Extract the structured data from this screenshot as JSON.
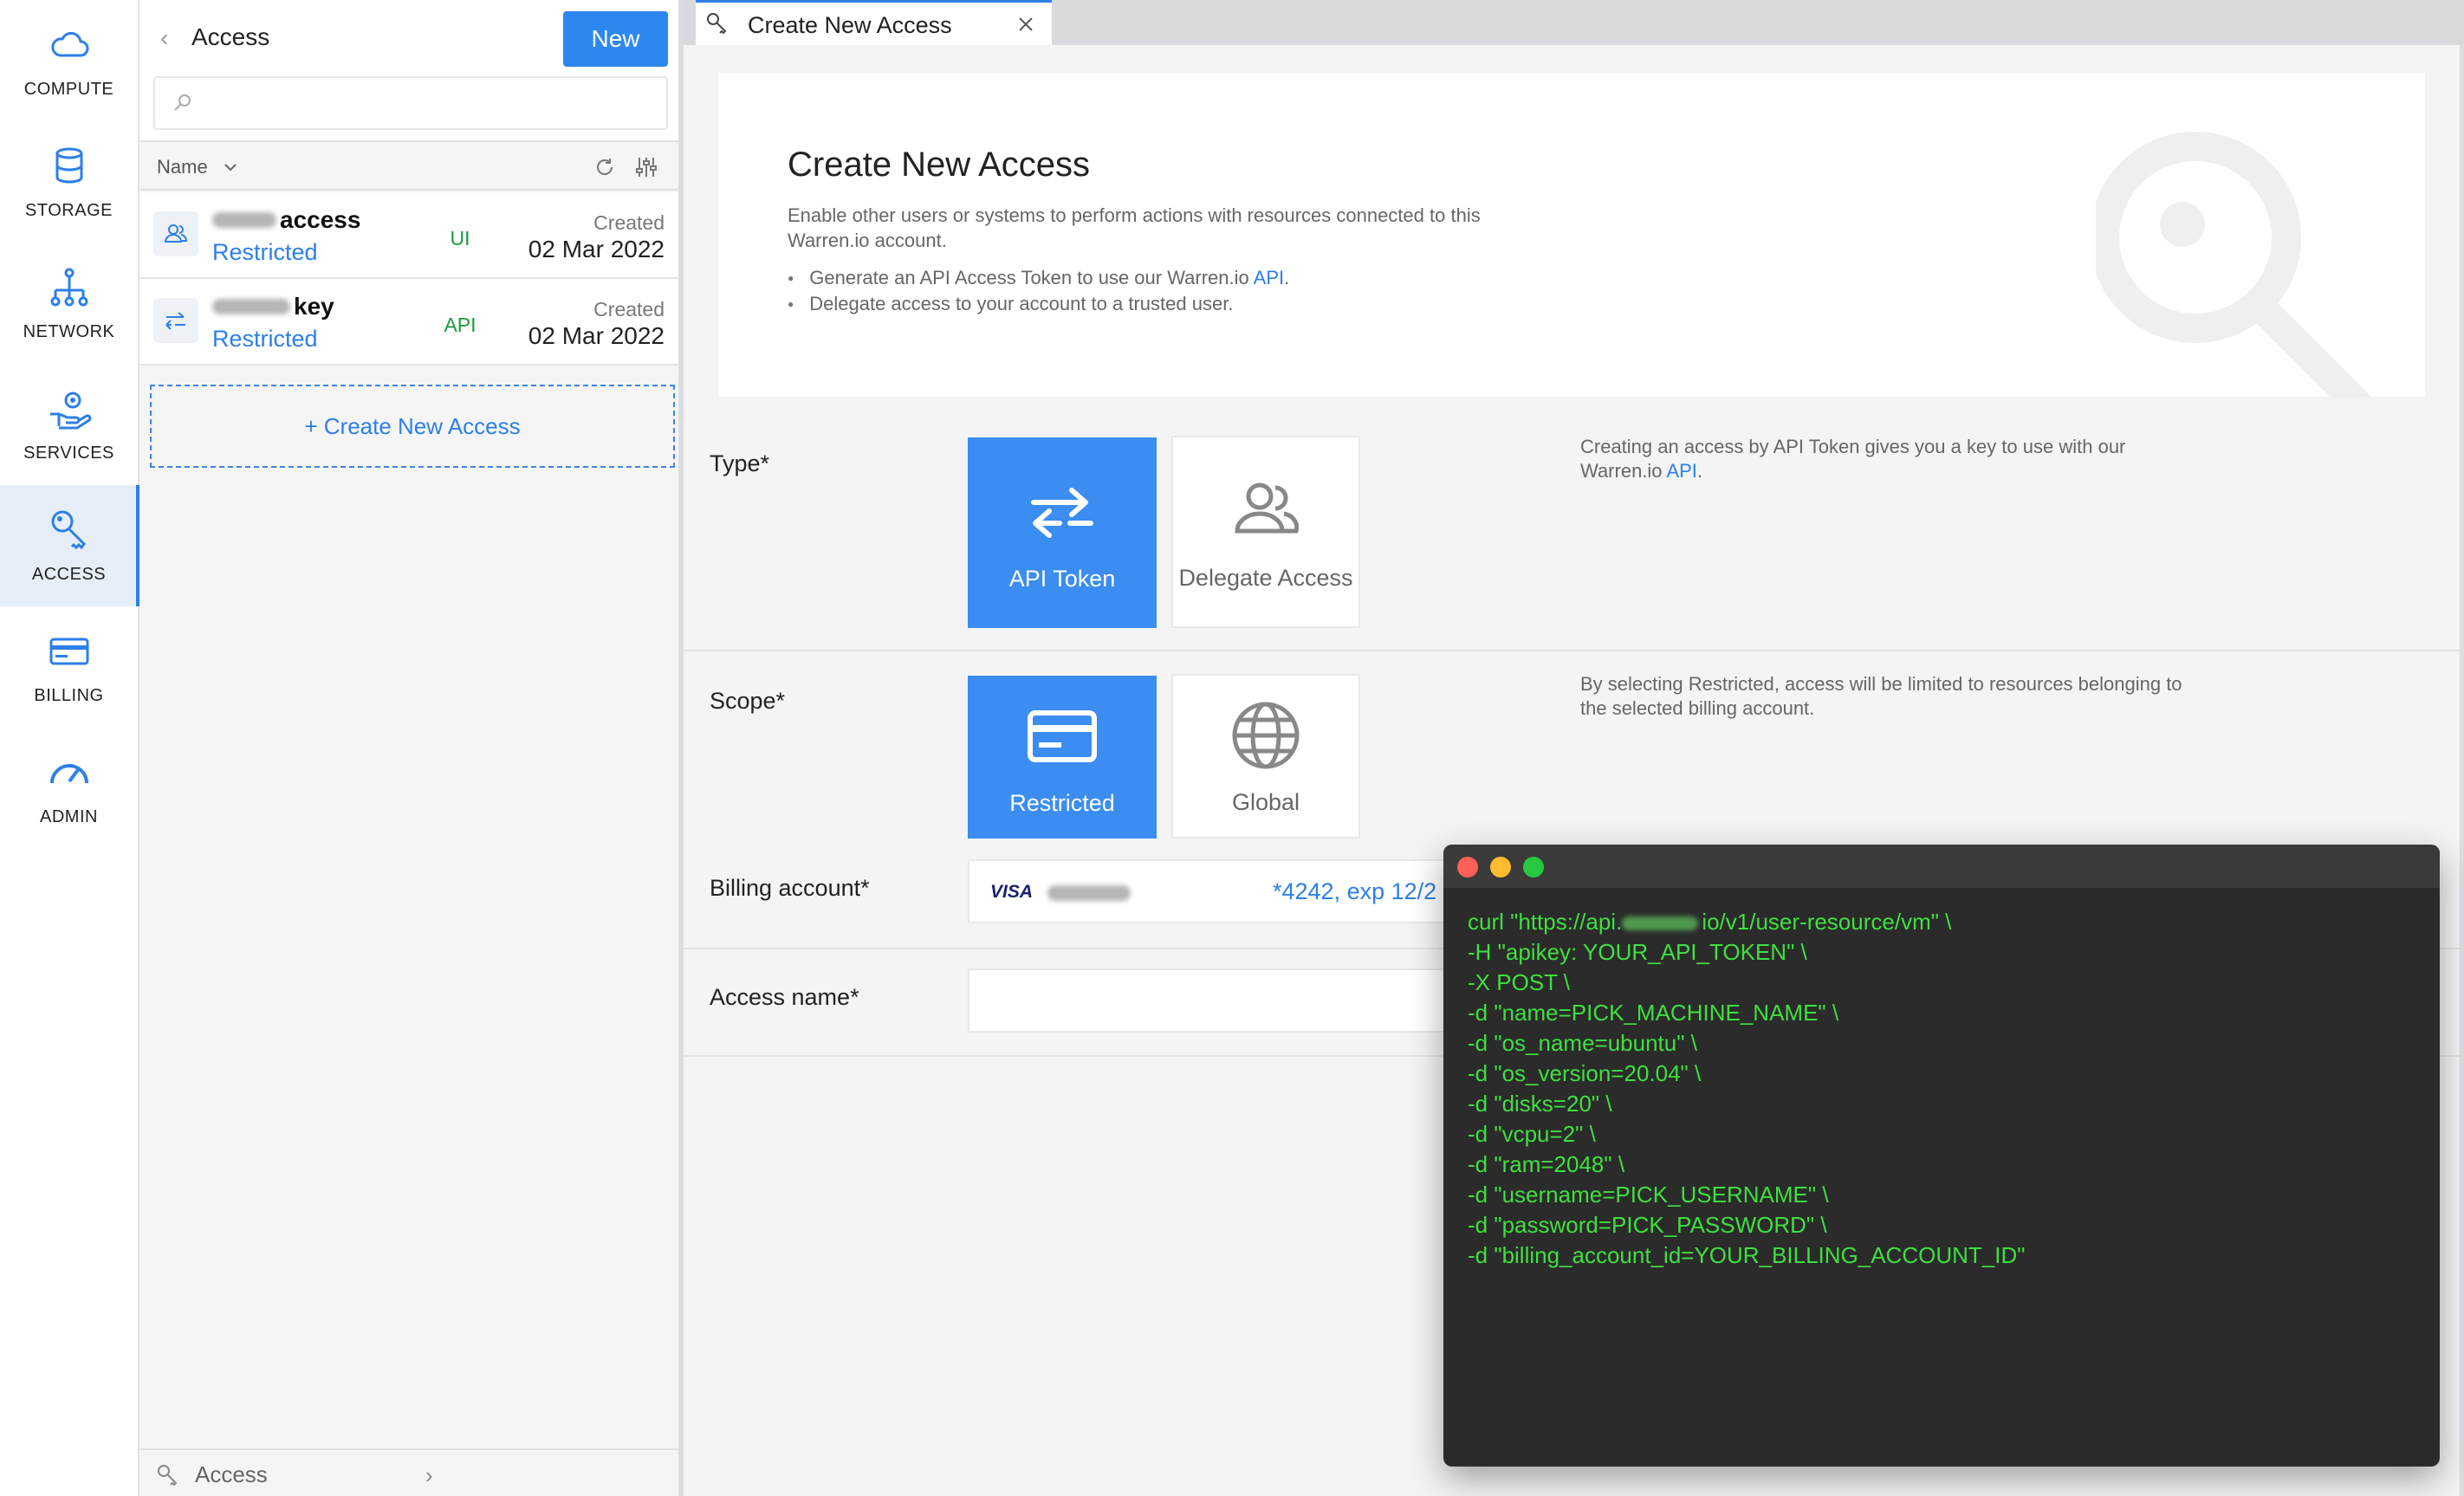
{
  "nav": {
    "items": [
      {
        "label": "COMPUTE",
        "icon": "cloud-icon"
      },
      {
        "label": "STORAGE",
        "icon": "database-icon"
      },
      {
        "label": "NETWORK",
        "icon": "network-icon"
      },
      {
        "label": "SERVICES",
        "icon": "services-icon"
      },
      {
        "label": "ACCESS",
        "icon": "key-icon",
        "active": true
      },
      {
        "label": "BILLING",
        "icon": "card-icon"
      },
      {
        "label": "ADMIN",
        "icon": "gauge-icon"
      }
    ]
  },
  "list": {
    "title": "Access",
    "new_label": "New",
    "search_placeholder": "",
    "col_name": "Name",
    "rows": [
      {
        "name": "access",
        "scope": "Restricted",
        "type": "UI",
        "created_label": "Created",
        "date": "02 Mar 2022",
        "icon": "delegate-user-icon"
      },
      {
        "name": "key",
        "scope": "Restricted",
        "type": "API",
        "created_label": "Created",
        "date": "02 Mar 2022",
        "icon": "api-arrows-icon"
      }
    ],
    "create_label": "+ Create New Access",
    "footer_label": "Access"
  },
  "tab": {
    "title": "Create New Access"
  },
  "hero": {
    "title": "Create New Access",
    "desc": "Enable other users or systems to perform actions with resources connected to this Warren.io account.",
    "bullet1_pre": "Generate an API Access Token to use our Warren.io ",
    "bullet1_link": "API",
    "bullet1_post": ".",
    "bullet2": "Delegate access to your account to a trusted user."
  },
  "form": {
    "type_label": "Type*",
    "type_options": [
      "API Token",
      "Delegate Access"
    ],
    "type_selected": "API Token",
    "type_help_pre": "Creating an access by API Token gives you a key to use with our Warren.io ",
    "type_help_link": "API",
    "type_help_post": ".",
    "scope_label": "Scope*",
    "scope_options": [
      "Restricted",
      "Global"
    ],
    "scope_selected": "Restricted",
    "scope_help": "By selecting Restricted, access will be limited to resources belonging to the selected billing account.",
    "billing_label": "Billing account*",
    "billing_brand": "VISA",
    "billing_card": "*4242, exp 12/2",
    "access_name_label": "Access name*",
    "access_name_value": ""
  },
  "terminal": {
    "line1_pre": "curl \"https://api.",
    "line1_post": "io/v1/user-resource/vm\" \\",
    "lines": [
      "-H \"apikey: YOUR_API_TOKEN\" \\",
      "-X POST \\",
      "-d \"name=PICK_MACHINE_NAME\" \\",
      "-d \"os_name=ubuntu\" \\",
      "-d \"os_version=20.04\" \\",
      "-d \"disks=20\" \\",
      "-d \"vcpu=2\" \\",
      "-d \"ram=2048\" \\",
      "-d \"username=PICK_USERNAME\" \\",
      "-d \"password=PICK_PASSWORD\" \\",
      "-d \"billing_account_id=YOUR_BILLING_ACCOUNT_ID\""
    ]
  },
  "colors": {
    "accent": "#2d87f0",
    "selected_tile": "#3b8df2",
    "terminal_text": "#3ee03e",
    "type_badge": "#1a9a3a"
  }
}
